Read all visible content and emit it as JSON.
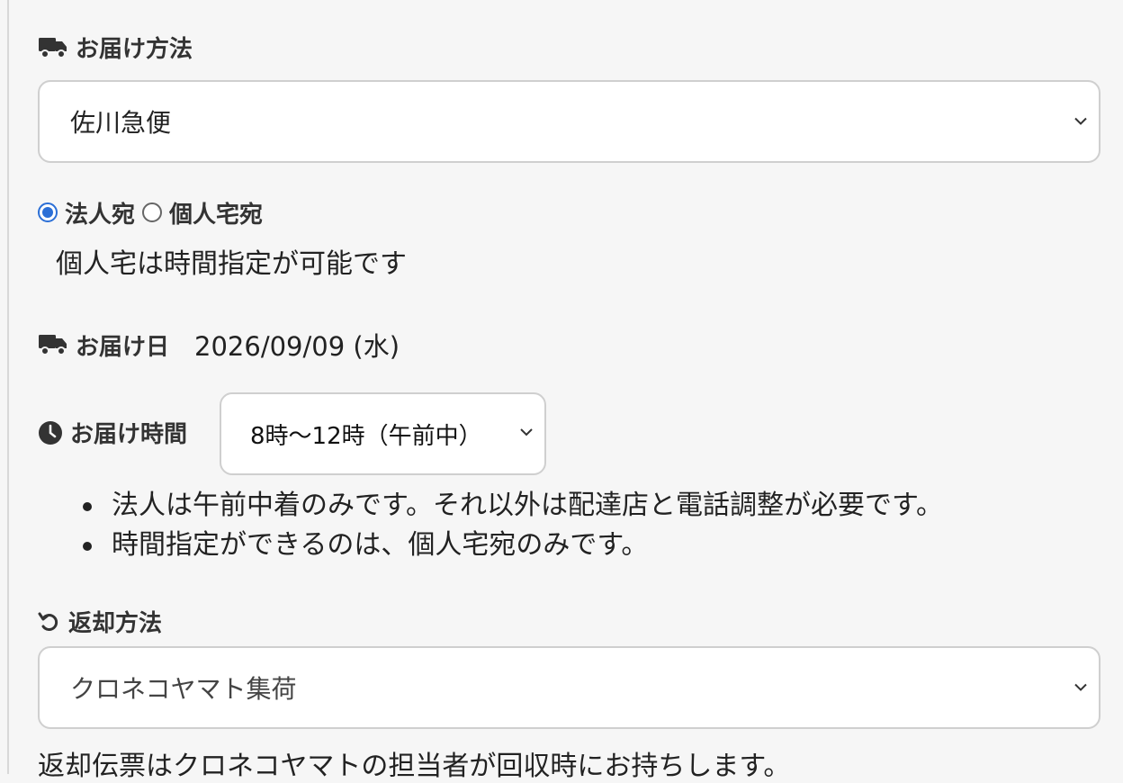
{
  "delivery_method": {
    "label": "お届け方法",
    "icon": "truck-icon",
    "selected": "佐川急便"
  },
  "recipient_type": {
    "options": [
      {
        "label": "法人宛",
        "checked": true
      },
      {
        "label": "個人宅宛",
        "checked": false
      }
    ],
    "note": "個人宅は時間指定が可能です"
  },
  "delivery_date": {
    "label": "お届け日",
    "icon": "truck-icon",
    "value": "2026/09/09 (水)"
  },
  "delivery_time": {
    "label": "お届け時間",
    "icon": "clock-icon",
    "selected": "8時〜12時（午前中）",
    "notes": [
      "法人は午前中着のみです。それ以外は配達店と電話調整が必要です。",
      "時間指定ができるのは、個人宅宛のみです。"
    ]
  },
  "return_method": {
    "label": "返却方法",
    "icon": "undo-icon",
    "selected": "クロネコヤマト集荷",
    "note": "返却伝票はクロネコヤマトの担当者が回収時にお持ちします。"
  },
  "colors": {
    "accent": "#2b6fd6",
    "background": "#f6f6f6",
    "border": "#cfcfcf"
  }
}
